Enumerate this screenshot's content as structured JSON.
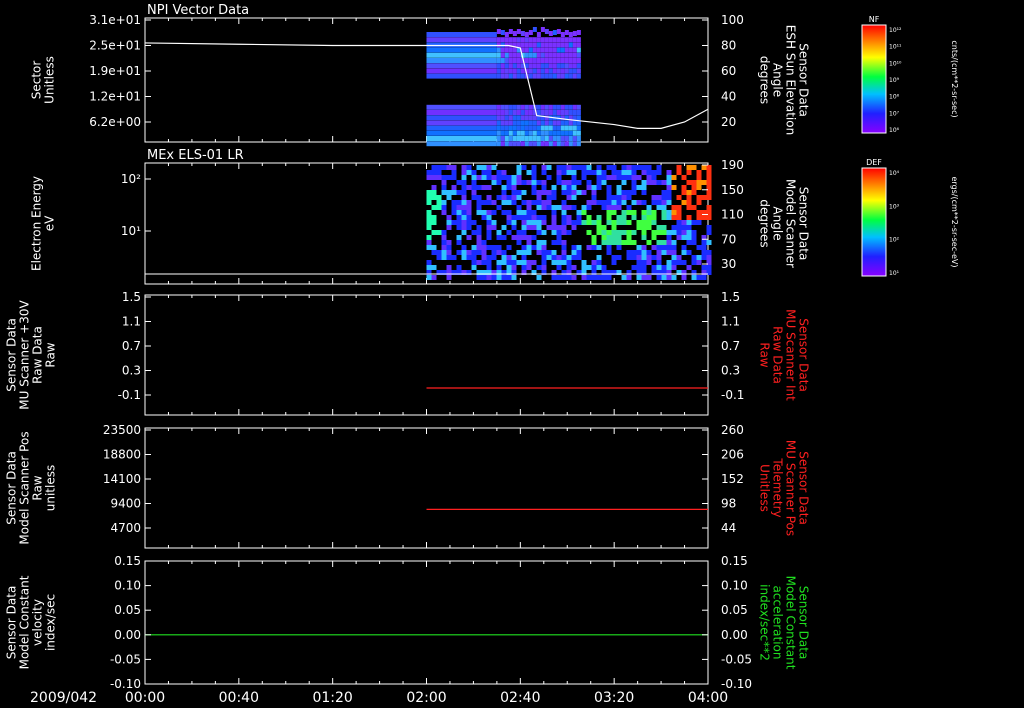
{
  "date_label": "2009/042",
  "time_ticks": [
    "00:00",
    "00:40",
    "01:20",
    "02:00",
    "02:40",
    "03:20",
    "04:00"
  ],
  "colors": {
    "red_trace": "#ff2020",
    "green_trace": "#20e020",
    "axis": "#ffffff",
    "background": "#000000"
  },
  "panels": [
    {
      "id": "npi",
      "title": "NPI Vector Data",
      "left_label": [
        "Sector",
        "Unitless"
      ],
      "left_ticks": [
        "3.1e+01",
        "2.5e+01",
        "1.9e+01",
        "1.2e+01",
        "6.2e+00"
      ],
      "right_label": [
        "Sensor Data",
        "ESH Sun Elevation",
        "Angle",
        "degrees"
      ],
      "right_ticks": [
        "100",
        "80",
        "60",
        "40",
        "20"
      ],
      "right_label_color": "#ffffff"
    },
    {
      "id": "els",
      "title": "MEx ELS-01 LR",
      "left_label": [
        "Electron Energy",
        "eV"
      ],
      "left_ticks": [
        "10²",
        "10¹"
      ],
      "right_label": [
        "Sensor Data",
        "Model Scanner",
        "Angle",
        "degrees"
      ],
      "right_ticks": [
        "190",
        "150",
        "110",
        "70",
        "30"
      ],
      "right_label_color": "#ffffff"
    },
    {
      "id": "mu_int",
      "title": "",
      "left_label": [
        "Sensor Data",
        "MU Scanner +30V",
        "Raw Data",
        "Raw"
      ],
      "left_ticks": [
        "1.5",
        "1.1",
        "0.7",
        "0.3",
        "-0.1"
      ],
      "right_label": [
        "Sensor Data",
        "MU Scanner Int",
        "Raw Data",
        "Raw"
      ],
      "right_ticks": [
        "1.5",
        "1.1",
        "0.7",
        "0.3",
        "-0.1"
      ],
      "right_label_color": "#ff2020"
    },
    {
      "id": "scanner_pos",
      "title": "",
      "left_label": [
        "Sensor Data",
        "Model Scanner Pos",
        "Raw",
        "unitless"
      ],
      "left_ticks": [
        "23500",
        "18800",
        "14100",
        "9400",
        "4700"
      ],
      "right_label": [
        "Sensor Data",
        "MU Scanner Pos",
        "Telemetry",
        "Unitless"
      ],
      "right_ticks": [
        "260",
        "206",
        "152",
        "98",
        "44"
      ],
      "right_label_color": "#ff2020"
    },
    {
      "id": "velocity",
      "title": "",
      "left_label": [
        "Sensor Data",
        "Model Constant",
        "velocity",
        "index/sec"
      ],
      "left_ticks": [
        "0.15",
        "0.10",
        "0.05",
        "0.00",
        "-0.05",
        "-0.10"
      ],
      "right_label": [
        "Sensor Data",
        "Model Constant",
        "acceleration",
        "index/sec**2"
      ],
      "right_ticks": [
        "0.15",
        "0.10",
        "0.05",
        "0.00",
        "-0.05",
        "-0.10"
      ],
      "right_label_color": "#20e020"
    }
  ],
  "colorbars": [
    {
      "label": "NF",
      "units": "cnts/(cm**2-sr-sec)",
      "ticks": [
        "10¹²",
        "10¹¹",
        "10¹⁰",
        "10⁹",
        "10⁸",
        "10⁷",
        "10⁶"
      ]
    },
    {
      "label": "DEF",
      "units": "ergs/(cm**2-sr-sec-eV)",
      "ticks": [
        "10⁴",
        "10³",
        "10²",
        "10¹"
      ]
    }
  ],
  "chart_data": [
    {
      "type": "line",
      "panel": "npi",
      "series_name": "Sensor Data ESH Sun Elevation Angle",
      "x": [
        "00:00",
        "00:40",
        "01:20",
        "02:00",
        "02:30",
        "02:35",
        "02:40",
        "02:47",
        "03:00",
        "03:20",
        "03:30",
        "03:40",
        "03:50",
        "04:00"
      ],
      "y_degrees": [
        82,
        81,
        80,
        80,
        80,
        80,
        78,
        25,
        22,
        18,
        15,
        15,
        20,
        30
      ],
      "ylim": [
        0,
        100
      ],
      "spectrogram": "NF sector-vs-time intensity, data present 02:00 to 03:05"
    },
    {
      "type": "heatmap",
      "panel": "els",
      "description": "Electron energy spectrogram, data 02:00 to 04:00; high flux (red) near 100 eV after 03:50",
      "scanner_angle_line_degrees": 12,
      "xlim": [
        "02:00",
        "04:00"
      ]
    },
    {
      "type": "line",
      "panel": "mu_int",
      "series_name": "Sensor Data MU Scanner Int Raw Data",
      "x": [
        "02:00",
        "04:00"
      ],
      "y": [
        -0.1,
        -0.1
      ],
      "ylim": [
        -0.1,
        1.5
      ]
    },
    {
      "type": "line",
      "panel": "scanner_pos",
      "series_name": "Sensor Data MU Scanner Pos Telemetry",
      "x": [
        "02:00",
        "04:00"
      ],
      "y": [
        85,
        85
      ],
      "ylim": [
        30,
        260
      ]
    },
    {
      "type": "line",
      "panel": "velocity",
      "series_name": "Sensor Data Model Constant acceleration",
      "x": [
        "00:00",
        "04:00"
      ],
      "y": [
        0.0,
        0.0
      ],
      "ylim": [
        -0.1,
        0.15
      ]
    }
  ]
}
